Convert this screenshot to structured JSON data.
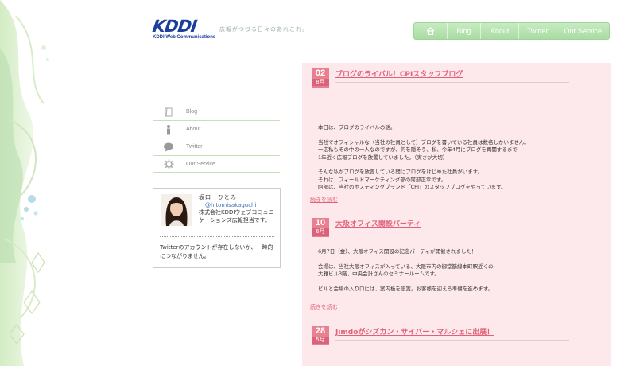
{
  "header": {
    "logo_text": "KDDI",
    "logo_subtext": "KDDI Web Communications",
    "tagline": "広報がつづる日々のあれこれ。"
  },
  "nav": {
    "home_icon": "home-icon",
    "items": [
      "Blog",
      "About",
      "Twitter",
      "Our Service"
    ]
  },
  "sidebar": {
    "items": [
      {
        "label": "Blog",
        "icon": "notebook-icon"
      },
      {
        "label": "About",
        "icon": "person-icon"
      },
      {
        "label": "Twitter",
        "icon": "speech-bubble-icon"
      },
      {
        "label": "Our Service",
        "icon": "gear-icon"
      }
    ]
  },
  "profile": {
    "name": "坂口　ひとみ",
    "handle": "@hitomisakaguchi",
    "desc": "株式会社KDDIウェブコミュニケーションズ広報担当です。",
    "note": "Twitterのアカウントが存在しないか、一時的につながりません。"
  },
  "posts": [
    {
      "day": "02",
      "month": "8月",
      "title": "ブログのライバル！CPIスタッフブログ",
      "paragraphs": [
        "本日は、ブログのライバルの話。",
        "当社でオフィシャルな（当社の社員として）ブログを書いている社員は数名しかいません。\n一応私もその中の一人なのですが、何を隠そう、私、今年4月にブログを再開するまで\n1年近く広報ブログを放置していました。（実さが大切）",
        "そんな私がブログを放置している間にブログをはじめた社員がいます。\nそれは、フィールドマーケティング部の阿部正幸です。\n阿部は、当社のホスティングブランド「CPI」のスタッフブログをやっています。"
      ],
      "read_more": "続きを読む"
    },
    {
      "day": "10",
      "month": "6月",
      "title": "大阪オフィス開設パーティ",
      "paragraphs": [
        "6月7日（金）、大阪オフィス開設の記念パーティが開催されました！",
        "会場は、当社大阪オフィスが入っている、大阪市内の御堂筋線本町駅近くの\n大雅ビル3階、中央会計さんのセミナールームです。",
        "ビルと会場の入り口には、案内板を設置。お客様を迎える準備を進めます。"
      ],
      "read_more": "続きを読む"
    },
    {
      "day": "28",
      "month": "5月",
      "title": "Jimdoがシズカン・サイバー・マルシェに出展！"
    }
  ],
  "colors": {
    "accent_pink": "#e06278",
    "nav_green": "#a9dca2",
    "main_bg": "#fde8ec",
    "logo_blue": "#1b3f9a"
  }
}
